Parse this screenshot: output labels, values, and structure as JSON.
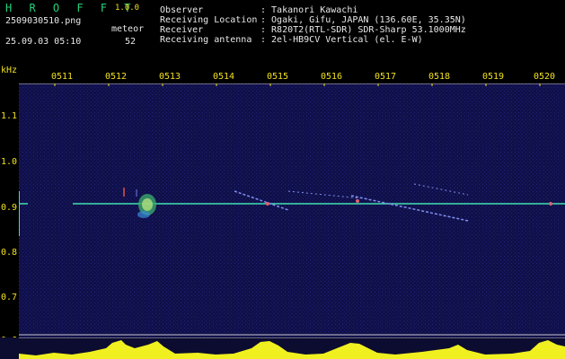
{
  "header": {
    "app_name": "H R O F F T",
    "version": "1.0.0",
    "filename": "2509030510.png",
    "datetime": "25.09.03 05:10",
    "meteor_label": "meteor",
    "meteor_count": "52",
    "info": [
      {
        "key": "Observer",
        "value": ": Takanori Kawachi"
      },
      {
        "key": "Receiving Location",
        "value": ": Ogaki, Gifu, JAPAN (136.60E, 35.35N)"
      },
      {
        "key": "Receiver",
        "value": ": R820T2(RTL-SDR) SDR-Sharp 53.1000MHz"
      },
      {
        "key": "Receiving antenna",
        "value": ": 2el-HB9CV Vertical (el. E-W)"
      }
    ]
  },
  "axes": {
    "y_unit": "kHz",
    "y_ticks": [
      "1.1",
      "1.0",
      "0.9",
      "0.8",
      "0.7",
      "0.6"
    ],
    "x_ticks": [
      "0511",
      "0512",
      "0513",
      "0514",
      "0515",
      "0516",
      "0517",
      "0518",
      "0519",
      "0520"
    ]
  },
  "colors": {
    "background": "#000000",
    "spectrogram_bg": "#10104a",
    "text": "#e8e8e8",
    "axis_labels": "#f0e020",
    "logo": "#22d27a",
    "carrier_line": "#40e0b0",
    "histogram": "#f0f020"
  }
}
